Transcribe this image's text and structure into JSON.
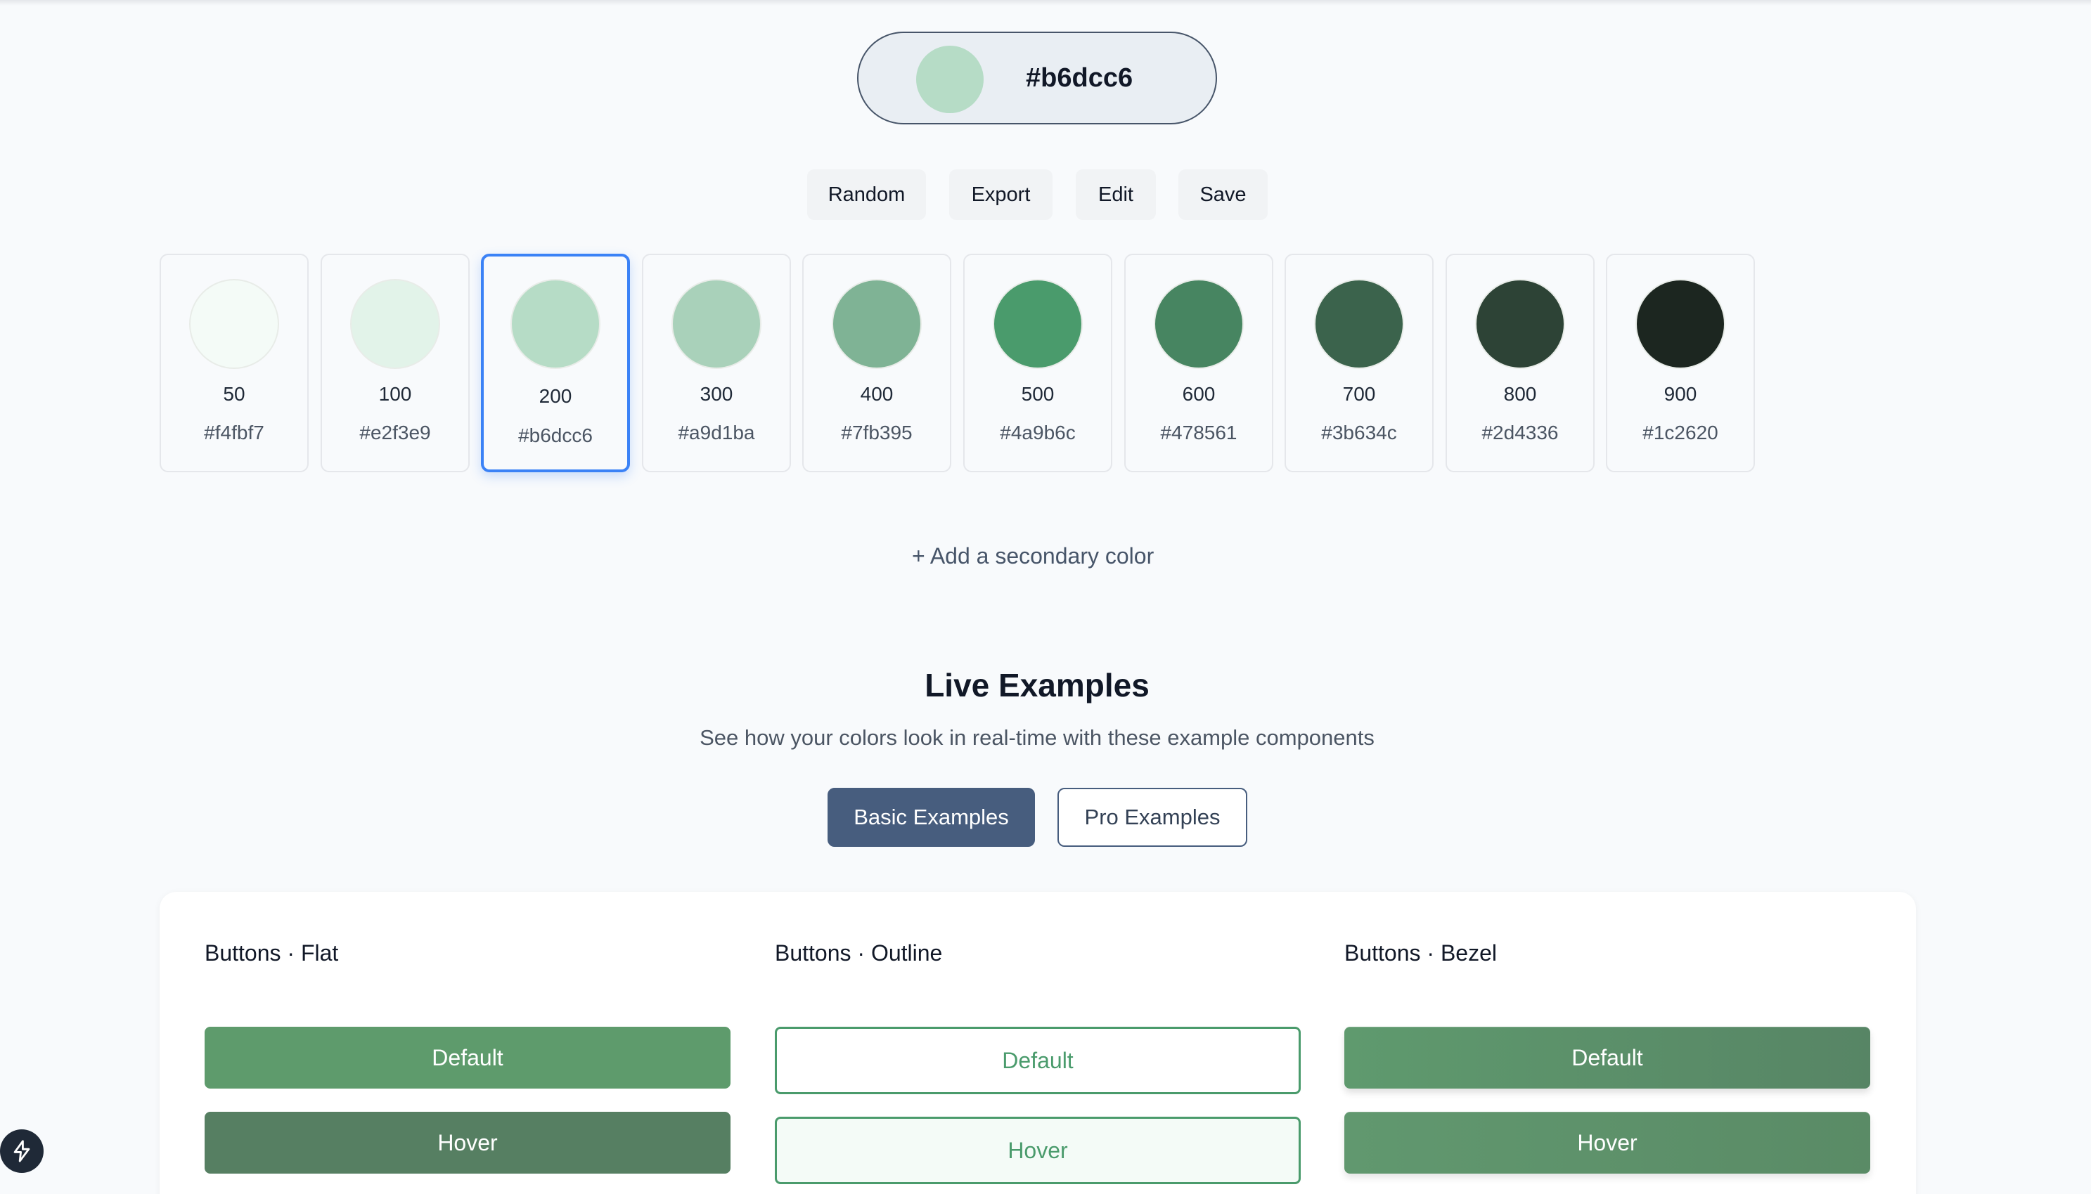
{
  "picker": {
    "hex": "#b6dcc6",
    "swatch_color": "#b6dcc6"
  },
  "actions": {
    "random": "Random",
    "export": "Export",
    "edit": "Edit",
    "save": "Save"
  },
  "shades": [
    {
      "level": "50",
      "code": "#f4fbf7",
      "color": "#f4fbf7"
    },
    {
      "level": "100",
      "code": "#e2f3e9",
      "color": "#e2f3e9"
    },
    {
      "level": "200",
      "code": "#b6dcc6",
      "color": "#b6dcc6"
    },
    {
      "level": "300",
      "code": "#a9d1ba",
      "color": "#a9d1ba"
    },
    {
      "level": "400",
      "code": "#7fb395",
      "color": "#7fb395"
    },
    {
      "level": "500",
      "code": "#4a9b6c",
      "color": "#4a9b6c"
    },
    {
      "level": "600",
      "code": "#478561",
      "color": "#478561"
    },
    {
      "level": "700",
      "code": "#3b634c",
      "color": "#3b634c"
    },
    {
      "level": "800",
      "code": "#2d4336",
      "color": "#2d4336"
    },
    {
      "level": "900",
      "code": "#1c2620",
      "color": "#1c2620"
    }
  ],
  "selected_shade": "200",
  "add_secondary": "+ Add a secondary color",
  "live": {
    "title": "Live Examples",
    "subtitle": "See how your colors look in real-time with these example components",
    "tab_basic": "Basic Examples",
    "tab_pro": "Pro Examples"
  },
  "examples": {
    "flat": {
      "title": "Buttons · Flat",
      "default": "Default",
      "hover": "Hover"
    },
    "outline": {
      "title": "Buttons · Outline",
      "default": "Default",
      "hover": "Hover"
    },
    "bezel": {
      "title": "Buttons · Bezel",
      "default": "Default",
      "hover": "Hover"
    }
  },
  "icons": {
    "badge": "bolt-icon"
  },
  "colors": {
    "accent": "#475d7e",
    "selection": "#3b82f6",
    "primary": "#4a9b6c"
  }
}
